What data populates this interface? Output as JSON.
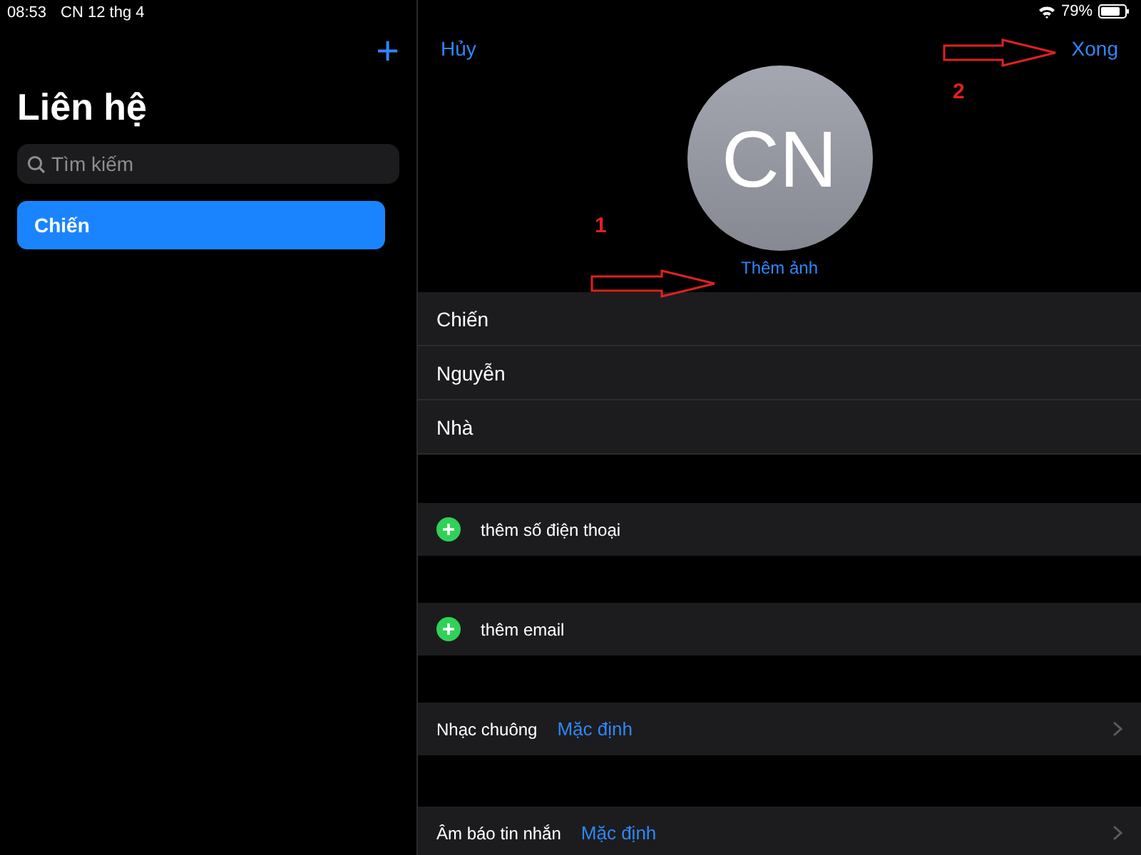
{
  "status_bar": {
    "time": "08:53",
    "date": "CN 12 thg 4",
    "battery": "79%"
  },
  "sidebar": {
    "title": "Liên hệ",
    "add_button": "+",
    "search": {
      "placeholder": "Tìm kiếm"
    },
    "contacts": [
      {
        "name": "Chiến",
        "selected": true
      }
    ]
  },
  "editor": {
    "cancel": "Hủy",
    "done": "Xong",
    "initials": "CN",
    "add_photo": "Thêm ảnh",
    "name_fields": [
      {
        "value": "Chiến"
      },
      {
        "value": "Nguyễn"
      },
      {
        "value": "Nhà"
      }
    ],
    "sections": [
      {
        "kind": "add",
        "label": "thêm số điện thoại"
      },
      {
        "kind": "add",
        "label": "thêm email"
      },
      {
        "kind": "setting",
        "label": "Nhạc chuông",
        "value": "Mặc định"
      },
      {
        "kind": "setting",
        "label": "Âm báo tin nhắn",
        "value": "Mặc định"
      }
    ]
  },
  "annotations": [
    {
      "number": "1",
      "kind": "photo"
    },
    {
      "number": "2",
      "kind": "done"
    }
  ]
}
